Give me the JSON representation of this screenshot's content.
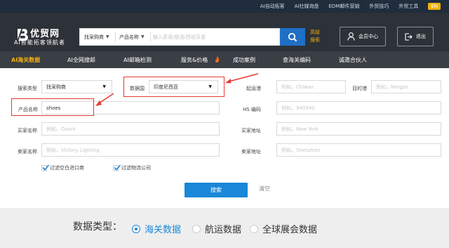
{
  "topbar": {
    "links": [
      "AI自动拓客",
      "AI社媒询盘",
      "EDM邮件营销",
      "外贸技巧",
      "外贸工具"
    ],
    "lang": "EN"
  },
  "header": {
    "brand": "优贸网",
    "tagline": "AI智能拓客领航者",
    "search": {
      "type_select": "找采购商",
      "field_select": "产品名称",
      "placeholder": "输入英语/俄语/西班牙语"
    },
    "advanced_search": "高级搜索",
    "member_center": "会员中心",
    "logout": "退出"
  },
  "nav": {
    "items": [
      "AI海关数据",
      "AI全网搜邮",
      "AI邮箱检测",
      "服务&价格",
      "成功案例",
      "查海关编码",
      "诚邀合伙人"
    ]
  },
  "form": {
    "search_type": {
      "label": "搜索类型",
      "value": "找采购商"
    },
    "data_country": {
      "label": "数据国",
      "value": "印度尼西亚"
    },
    "origin_port": {
      "label": "起运港",
      "placeholder": "例如，Chiwan"
    },
    "dest_port": {
      "label": "目的港",
      "placeholder": "例如，Ningpo"
    },
    "product_name": {
      "label": "产品名称",
      "value": "shoes"
    },
    "hs_code": {
      "label": "HS 编码",
      "placeholder": "例如，940540"
    },
    "buyer_name": {
      "label": "买家名称",
      "placeholder": "例如，Ozark"
    },
    "buyer_address": {
      "label": "买家地址",
      "placeholder": "例如，New York"
    },
    "seller_name": {
      "label": "卖家名称",
      "placeholder": "例如，Victory Lighting"
    },
    "seller_address": {
      "label": "卖家地址",
      "placeholder": "例如，Shenzhen"
    },
    "filter_blank_importers": "过滤空白进口商",
    "filter_logistics": "过滤物流公司",
    "search_button": "搜索",
    "reset_button": "清空"
  },
  "data_type": {
    "label": "数据类型：",
    "options": [
      "海关数据",
      "航运数据",
      "全球展会数据"
    ],
    "selected": "海关数据"
  }
}
